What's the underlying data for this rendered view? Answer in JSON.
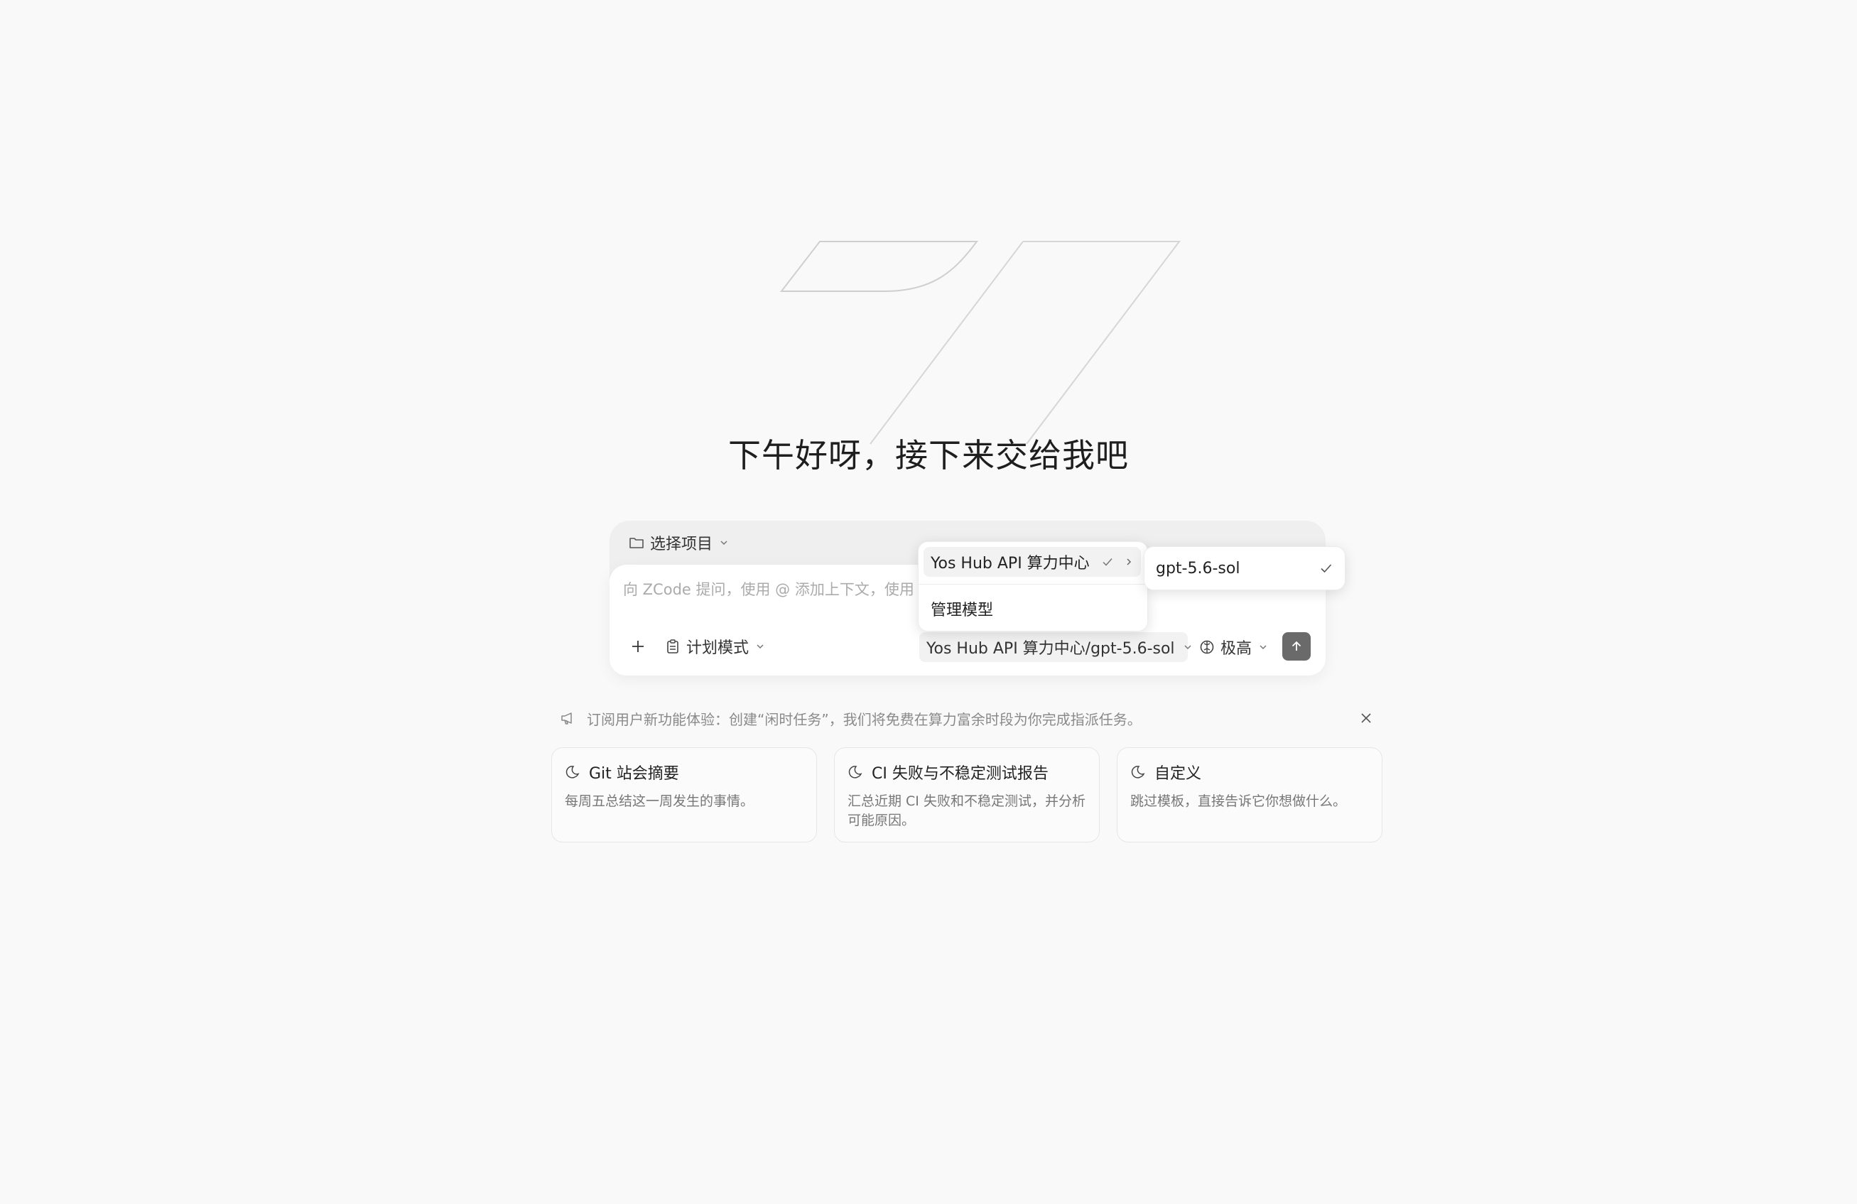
{
  "greeting": "下午好呀，接下来交给我吧",
  "composer": {
    "project_label": "选择项目",
    "prompt_placeholder": "向 ZCode 提问，使用 @ 添加上下文，使用 /",
    "mode_label": "计划模式",
    "model_label": "Yos Hub API 算力中心/gpt-5.6-sol",
    "effort_label": "极高"
  },
  "model_menu": {
    "provider": "Yos Hub API 算力中心",
    "manage": "管理模型",
    "submenu_model": "gpt-5.6-sol"
  },
  "notice": {
    "text": "订阅用户新功能体验：创建“闲时任务”，我们将免费在算力富余时段为你完成指派任务。"
  },
  "cards": [
    {
      "title": "Git 站会摘要",
      "desc": "每周五总结这一周发生的事情。"
    },
    {
      "title": "CI 失败与不稳定测试报告",
      "desc": "汇总近期 CI 失败和不稳定测试，并分析可能原因。"
    },
    {
      "title": "自定义",
      "desc": "跳过模板，直接告诉它你想做什么。"
    }
  ],
  "colors": {
    "background": "#f9f9f9",
    "send_button": "#6a6a6a",
    "muted_text": "#8a8a8a"
  }
}
